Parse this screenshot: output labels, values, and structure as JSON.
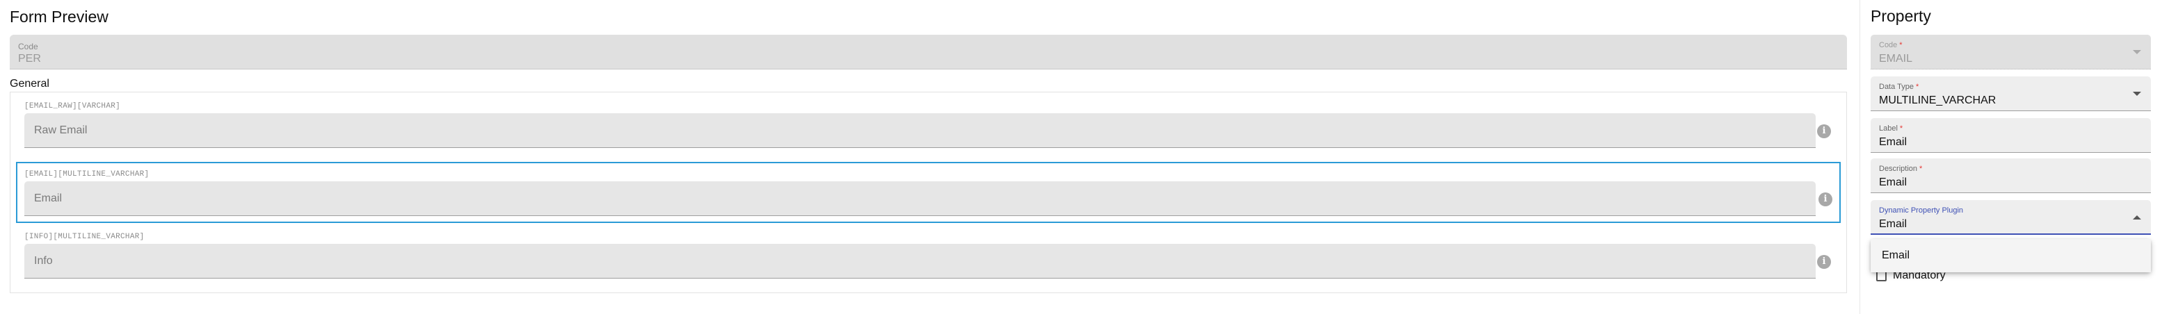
{
  "preview": {
    "title": "Form Preview",
    "code": {
      "label": "Code",
      "value": "PER"
    },
    "section_title": "General",
    "rows": [
      {
        "tag": "[EMAIL_RAW][VARCHAR]",
        "placeholder": "Raw Email",
        "selected": false
      },
      {
        "tag": "[EMAIL][MULTILINE_VARCHAR]",
        "placeholder": "Email",
        "selected": true
      },
      {
        "tag": "[INFO][MULTILINE_VARCHAR]",
        "placeholder": "Info",
        "selected": false
      }
    ],
    "info_glyph": "i"
  },
  "property": {
    "title": "Property",
    "code": {
      "label": "Code",
      "required": "*",
      "value": "EMAIL"
    },
    "data_type": {
      "label": "Data Type",
      "required": "*",
      "value": "MULTILINE_VARCHAR"
    },
    "label_field": {
      "label": "Label",
      "required": "*",
      "value": "Email"
    },
    "description": {
      "label": "Description",
      "required": "*",
      "value": "Email"
    },
    "plugin": {
      "label": "Dynamic Property Plugin",
      "value": "Email"
    },
    "dropdown_options": [
      "Email"
    ],
    "mandatory": {
      "label": "Mandatory",
      "checked": false
    }
  },
  "colors": {
    "selection_border": "#2b9bd6",
    "focus_accent": "#3f51b5",
    "required_star": "#e53935"
  },
  "icons": [
    "info-icon",
    "chevron-down-icon",
    "chevron-up-icon",
    "checkbox-icon"
  ]
}
